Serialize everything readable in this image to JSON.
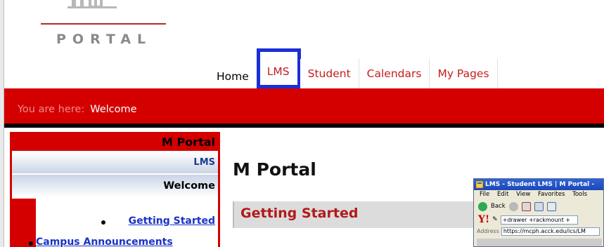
{
  "logo": {
    "wordmark": "PORTAL",
    "icon": "m-logo-icon"
  },
  "tabs": [
    {
      "label": "Home"
    },
    {
      "label": "LMS"
    },
    {
      "label": "Student"
    },
    {
      "label": "Calendars"
    },
    {
      "label": "My Pages"
    }
  ],
  "breadcrumb": {
    "prefix": "You are here:",
    "current": "Welcome"
  },
  "nav": {
    "title": "M Portal",
    "lms": "LMS",
    "welcome": "Welcome",
    "links": [
      "Getting Started",
      "Campus Announcements"
    ]
  },
  "main": {
    "title": "M Portal",
    "section_title": "Getting Started"
  },
  "inset_browser": {
    "title": "LMS - Student LMS | M Portal - ",
    "menus": [
      "File",
      "Edit",
      "View",
      "Favorites",
      "Tools"
    ],
    "back_label": "Back",
    "yahoo_logo": "Y!",
    "search_text": "+drawer +rackmount +",
    "address_label": "Address",
    "address_value": "https://mcph.acck.edu/ics/LM"
  },
  "colors": {
    "brand_red": "#d40000",
    "link_blue": "#1a33c4",
    "highlight_box": "#1b2fd6"
  }
}
